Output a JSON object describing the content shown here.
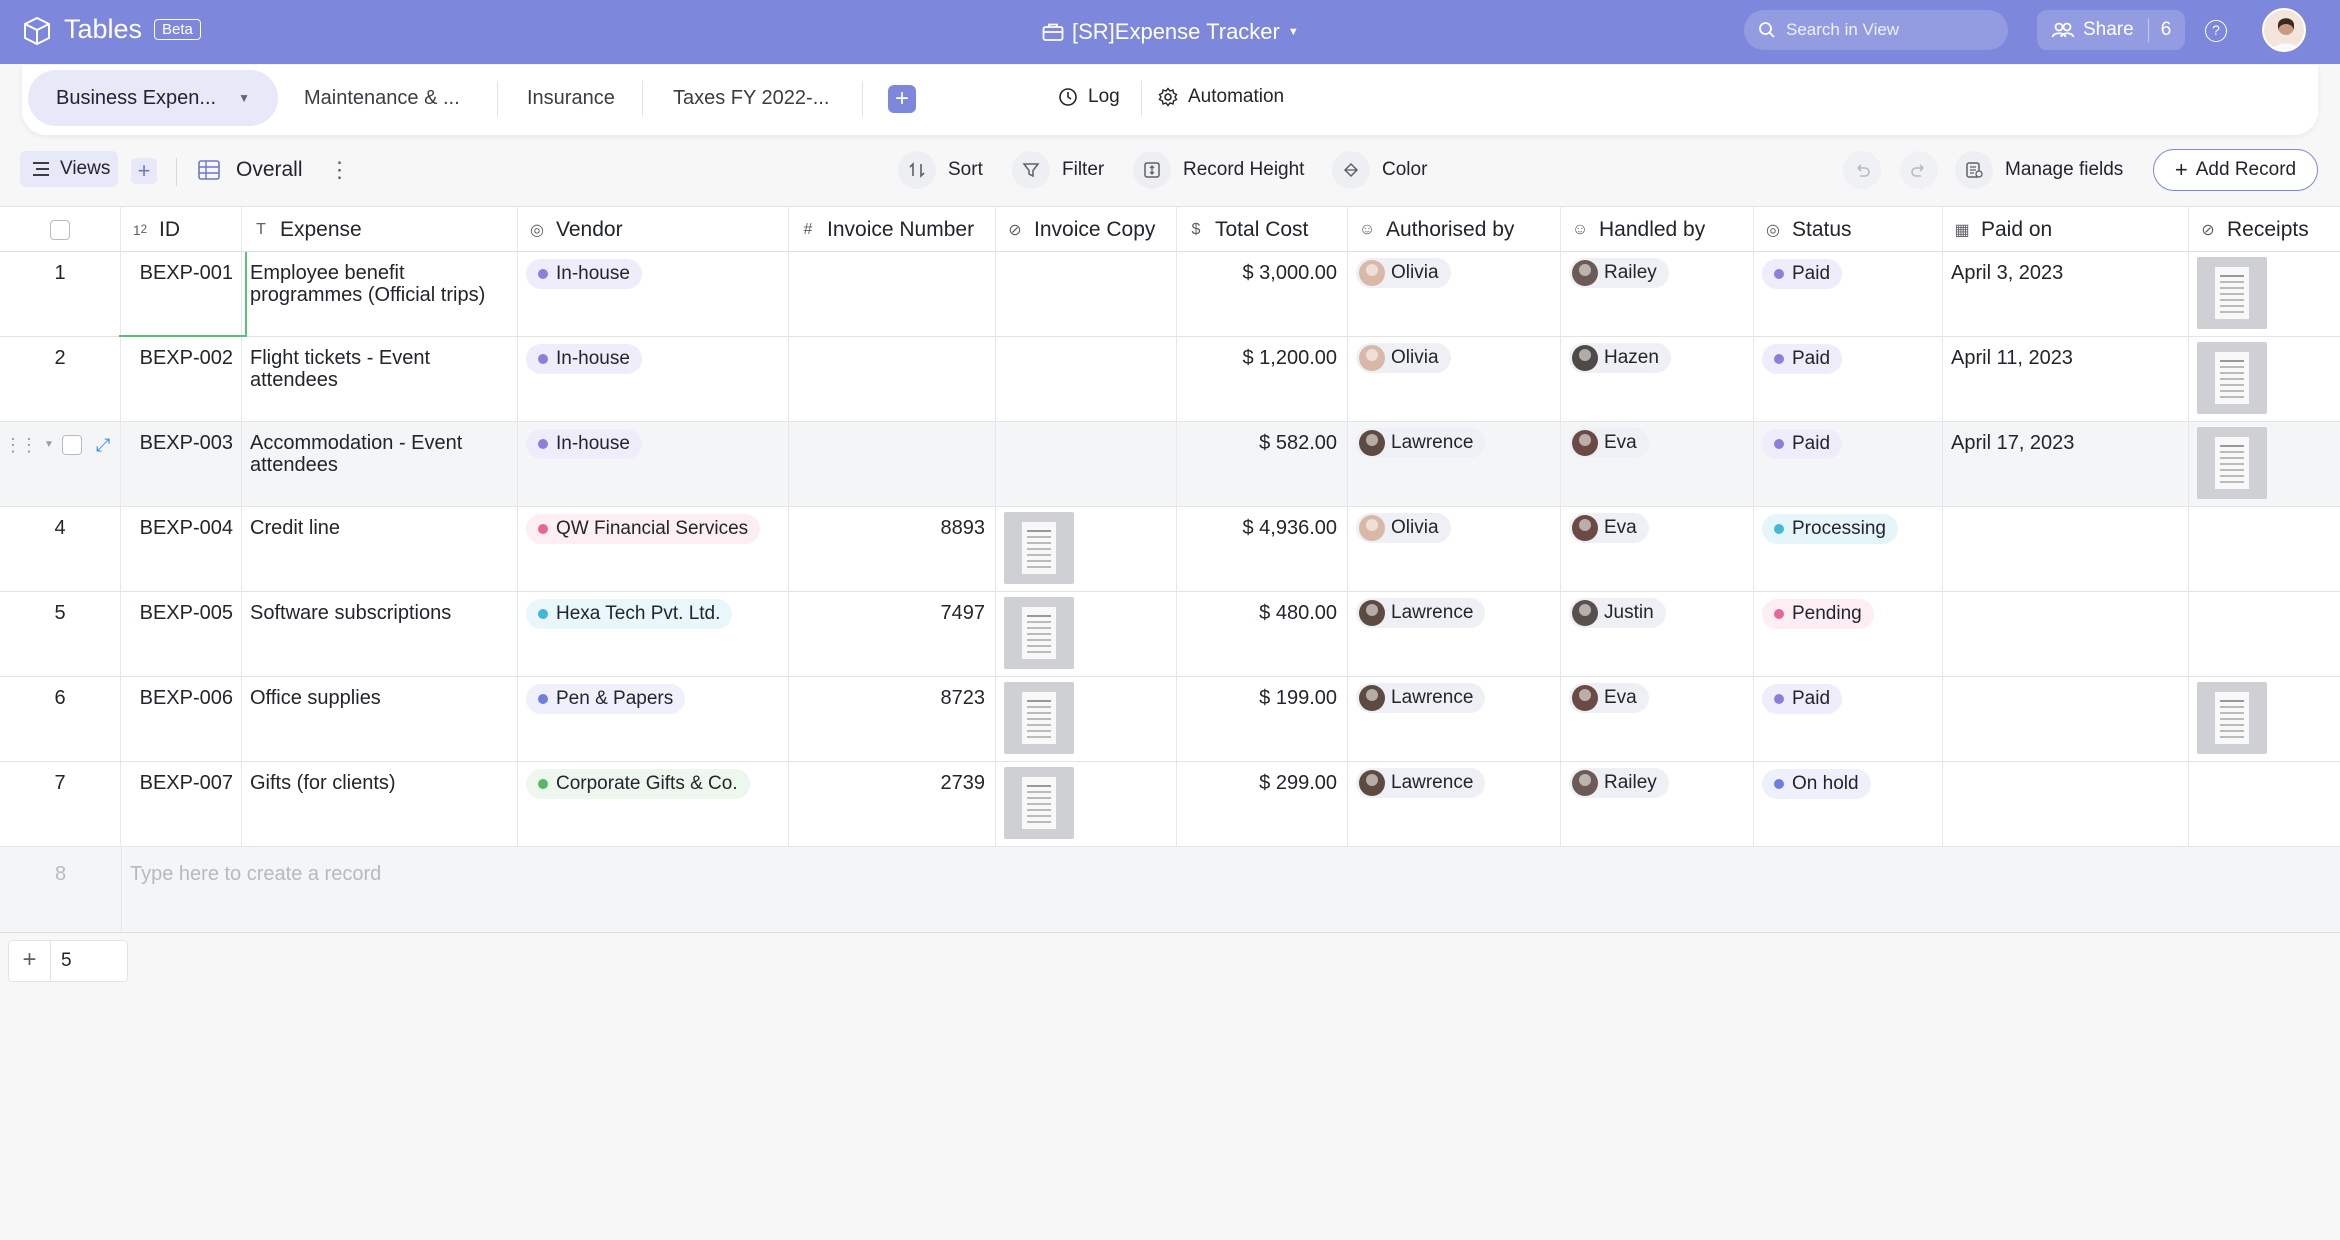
{
  "app": {
    "name": "Tables",
    "badge": "Beta",
    "title": "[SR]Expense Tracker"
  },
  "search": {
    "placeholder": "Search in View"
  },
  "share": {
    "label": "Share",
    "count": "6"
  },
  "tabs": [
    {
      "label": "Business Expen..."
    },
    {
      "label": "Maintenance & ..."
    },
    {
      "label": "Insurance"
    },
    {
      "label": "Taxes FY 2022-..."
    }
  ],
  "tabbar_right": {
    "log": "Log",
    "automation": "Automation"
  },
  "toolbar": {
    "views": "Views",
    "view_name": "Overall",
    "sort": "Sort",
    "filter": "Filter",
    "record_height": "Record Height",
    "color": "Color",
    "manage_fields": "Manage fields",
    "add_record": "Add Record"
  },
  "columns": [
    {
      "label": "ID",
      "icon": "number-icon"
    },
    {
      "label": "Expense",
      "icon": "text-icon"
    },
    {
      "label": "Vendor",
      "icon": "single-select-icon"
    },
    {
      "label": "Invoice Number",
      "icon": "hash-icon"
    },
    {
      "label": "Invoice Copy",
      "icon": "attachment-icon"
    },
    {
      "label": "Total Cost",
      "icon": "dollar-icon"
    },
    {
      "label": "Authorised by",
      "icon": "user-icon"
    },
    {
      "label": "Handled by",
      "icon": "user-icon"
    },
    {
      "label": "Status",
      "icon": "single-select-icon"
    },
    {
      "label": "Paid on",
      "icon": "calendar-icon"
    },
    {
      "label": "Receipts",
      "icon": "attachment-icon"
    }
  ],
  "rows": [
    {
      "num": "1",
      "id": "BEXP-001",
      "expense": "Employee benefit programmes (Official trips)",
      "vendor": "In-house",
      "invoice_number": "",
      "total": "$ 3,000.00",
      "authorised": "Olivia",
      "handled": "Railey",
      "status": "Paid",
      "paid_on": "April 3, 2023"
    },
    {
      "num": "2",
      "id": "BEXP-002",
      "expense": "Flight tickets - Event attendees",
      "vendor": "In-house",
      "invoice_number": "",
      "total": "$ 1,200.00",
      "authorised": "Olivia",
      "handled": "Hazen",
      "status": "Paid",
      "paid_on": "April 11, 2023"
    },
    {
      "num": "3",
      "id": "BEXP-003",
      "expense": "Accommodation - Event attendees",
      "vendor": "In-house",
      "invoice_number": "",
      "total": "$ 582.00",
      "authorised": "Lawrence",
      "handled": "Eva",
      "status": "Paid",
      "paid_on": "April 17, 2023"
    },
    {
      "num": "4",
      "id": "BEXP-004",
      "expense": "Credit line",
      "vendor": "QW Financial Services",
      "invoice_number": "8893",
      "total": "$ 4,936.00",
      "authorised": "Olivia",
      "handled": "Eva",
      "status": "Processing",
      "paid_on": ""
    },
    {
      "num": "5",
      "id": "BEXP-005",
      "expense": "Software subscriptions",
      "vendor": "Hexa Tech Pvt. Ltd.",
      "invoice_number": "7497",
      "total": "$ 480.00",
      "authorised": "Lawrence",
      "handled": "Justin",
      "status": "Pending",
      "paid_on": ""
    },
    {
      "num": "6",
      "id": "BEXP-006",
      "expense": "Office supplies",
      "vendor": "Pen & Papers",
      "invoice_number": "8723",
      "total": "$ 199.00",
      "authorised": "Lawrence",
      "handled": "Eva",
      "status": "Paid",
      "paid_on": ""
    },
    {
      "num": "7",
      "id": "BEXP-007",
      "expense": "Gifts (for clients)",
      "vendor": "Corporate Gifts & Co.",
      "invoice_number": "2739",
      "total": "$ 299.00",
      "authorised": "Lawrence",
      "handled": "Railey",
      "status": "On hold",
      "paid_on": ""
    }
  ],
  "new_row": {
    "num": "8",
    "hint": "Type here to create a record"
  },
  "footer": {
    "count": "5"
  },
  "colors": {
    "header_bg": "#7d87db",
    "vendor_inhouse": "#8b7fd9",
    "vendor_qw": "#e5679a",
    "vendor_hexa": "#41b8d6",
    "vendor_pen": "#6f7fe0",
    "vendor_corporate": "#58b86a",
    "status_paid": "#8b7fd9",
    "status_processing": "#41b8d6",
    "status_pending": "#e5679a",
    "status_onhold": "#6f7fe0"
  }
}
